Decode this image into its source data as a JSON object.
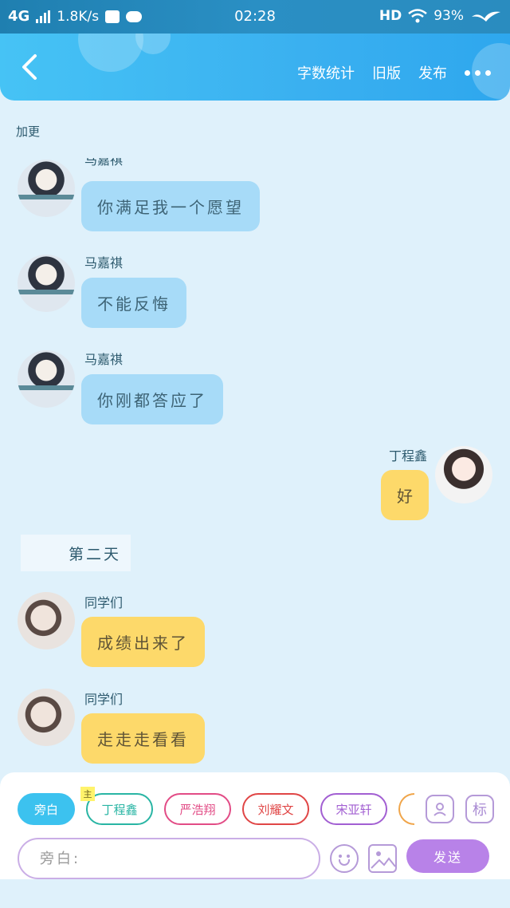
{
  "status_bar": {
    "network": "4G",
    "speed": "1.8K/s",
    "time": "02:28",
    "hd": "HD",
    "battery": "93%"
  },
  "header": {
    "actions": [
      "字数统计",
      "旧版",
      "发布"
    ]
  },
  "chat": {
    "note": "加更",
    "messages": [
      {
        "sender": "马嘉祺",
        "text": "你满足我一个愿望",
        "side": "left",
        "color": "blue"
      },
      {
        "sender": "马嘉祺",
        "text": "不能反悔",
        "side": "left",
        "color": "blue"
      },
      {
        "sender": "马嘉祺",
        "text": "你刚都答应了",
        "side": "left",
        "color": "blue"
      },
      {
        "sender": "丁程鑫",
        "text": "好",
        "side": "right",
        "color": "yellow"
      },
      {
        "sender": "同学们",
        "text": "成绩出来了",
        "side": "left",
        "color": "yellow"
      },
      {
        "sender": "同学们",
        "text": "走走走看看",
        "side": "left",
        "color": "yellow"
      }
    ],
    "day_marker": "第二天"
  },
  "composer": {
    "roles": {
      "narration": "旁白",
      "main_tag": "主",
      "r1": "丁程鑫",
      "r2": "严浩翔",
      "r3": "刘耀文",
      "r4": "宋亚轩"
    },
    "tool_label": "标",
    "input_placeholder": "旁白:",
    "send": "发送"
  },
  "colors": {
    "accent": "#3ab0f0",
    "bubble_blue": "#a7dbf8",
    "bubble_yellow": "#fdd96a",
    "send": "#b882e8"
  }
}
